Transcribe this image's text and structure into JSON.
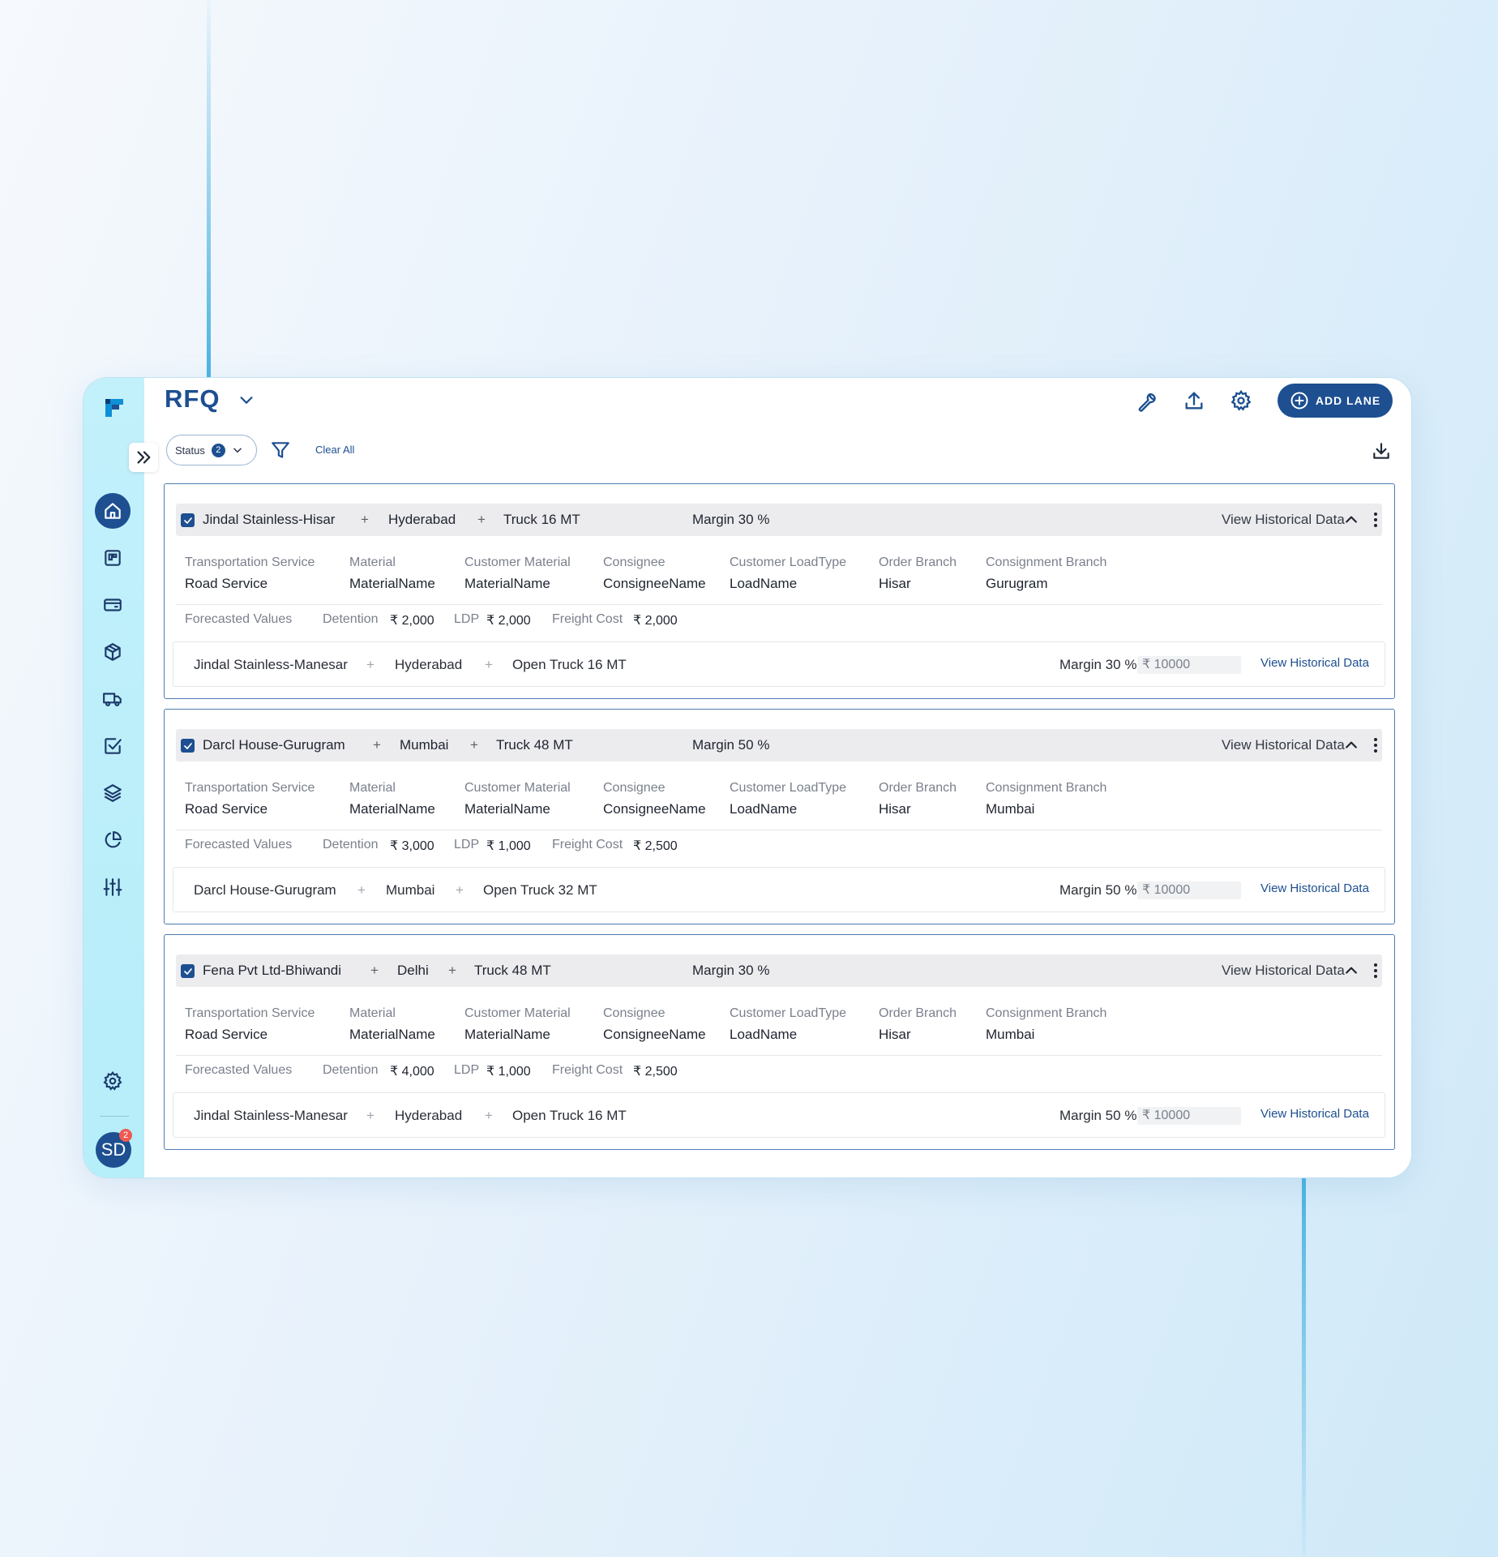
{
  "header": {
    "title": "RFQ",
    "add_lane_label": "ADD LANE"
  },
  "filters": {
    "status_label": "Status",
    "status_count": "2",
    "clear_all_label": "Clear All"
  },
  "user": {
    "initials": "SD",
    "notification_count": "2"
  },
  "colors": {
    "primary": "#1d4f91",
    "sidebar": "#b6eefa",
    "header_row": "#ececee"
  },
  "sidebar": {
    "items": [
      {
        "icon": "home-icon"
      },
      {
        "icon": "board-icon"
      },
      {
        "icon": "card-icon"
      },
      {
        "icon": "package-icon"
      },
      {
        "icon": "truck-icon"
      },
      {
        "icon": "checkbox-icon"
      },
      {
        "icon": "layers-icon"
      },
      {
        "icon": "pie-chart-icon"
      },
      {
        "icon": "sliders-icon"
      },
      {
        "icon": "settings-icon"
      }
    ]
  },
  "cards": [
    {
      "lane": {
        "source": "Jindal Stainless-Hisar",
        "destination": "Hyderabad",
        "vehicle": "Truck 16 MT",
        "margin": "Margin 30 %",
        "link": "View Historical Data"
      },
      "fields": [
        {
          "label": "Transportation Service",
          "value": "Road Service"
        },
        {
          "label": "Material",
          "value": "MaterialName"
        },
        {
          "label": "Customer Material",
          "value": "MaterialName"
        },
        {
          "label": "Consignee",
          "value": "ConsigneeName"
        },
        {
          "label": "Customer LoadType",
          "value": "LoadName"
        },
        {
          "label": "Order Branch",
          "value": "Hisar"
        },
        {
          "label": "Consignment Branch",
          "value": "Gurugram"
        }
      ],
      "forecast": {
        "label": "Forecasted Values",
        "detention_label": "Detention",
        "detention": "₹ 2,000",
        "ldp_label": "LDP",
        "ldp": "₹ 2,000",
        "freight_label": "Freight Cost",
        "freight": "₹ 2,000"
      },
      "sub": {
        "source": "Jindal Stainless-Manesar",
        "destination": "Hyderabad",
        "vehicle": "Open Truck 16 MT",
        "margin": "Margin 30 %",
        "amount": "₹ 10000",
        "link": "View Historical Data"
      }
    },
    {
      "lane": {
        "source": "Darcl House-Gurugram",
        "destination": "Mumbai",
        "vehicle": "Truck 48 MT",
        "margin": "Margin 50 %",
        "link": "View Historical Data"
      },
      "fields": [
        {
          "label": "Transportation Service",
          "value": "Road Service"
        },
        {
          "label": "Material",
          "value": "MaterialName"
        },
        {
          "label": "Customer Material",
          "value": "MaterialName"
        },
        {
          "label": "Consignee",
          "value": "ConsigneeName"
        },
        {
          "label": "Customer LoadType",
          "value": "LoadName"
        },
        {
          "label": "Order Branch",
          "value": "Hisar"
        },
        {
          "label": "Consignment Branch",
          "value": "Mumbai"
        }
      ],
      "forecast": {
        "label": "Forecasted Values",
        "detention_label": "Detention",
        "detention": "₹ 3,000",
        "ldp_label": "LDP",
        "ldp": "₹ 1,000",
        "freight_label": "Freight Cost",
        "freight": "₹ 2,500"
      },
      "sub": {
        "source": "Darcl House-Gurugram",
        "destination": "Mumbai",
        "vehicle": "Open Truck 32 MT",
        "margin": "Margin 50 %",
        "amount": "₹ 10000",
        "link": "View Historical Data"
      }
    },
    {
      "lane": {
        "source": "Fena Pvt Ltd-Bhiwandi",
        "destination": "Delhi",
        "vehicle": "Truck 48 MT",
        "margin": "Margin 30 %",
        "link": "View Historical Data"
      },
      "fields": [
        {
          "label": "Transportation Service",
          "value": "Road Service"
        },
        {
          "label": "Material",
          "value": "MaterialName"
        },
        {
          "label": "Customer Material",
          "value": "MaterialName"
        },
        {
          "label": "Consignee",
          "value": "ConsigneeName"
        },
        {
          "label": "Customer LoadType",
          "value": "LoadName"
        },
        {
          "label": "Order Branch",
          "value": "Hisar"
        },
        {
          "label": "Consignment Branch",
          "value": "Mumbai"
        }
      ],
      "forecast": {
        "label": "Forecasted Values",
        "detention_label": "Detention",
        "detention": "₹ 4,000",
        "ldp_label": "LDP",
        "ldp": "₹ 1,000",
        "freight_label": "Freight Cost",
        "freight": "₹ 2,500"
      },
      "sub": {
        "source": "Jindal Stainless-Manesar",
        "destination": "Hyderabad",
        "vehicle": "Open Truck 16 MT",
        "margin": "Margin 50 %",
        "amount": "₹ 10000",
        "link": "View Historical Data"
      }
    }
  ]
}
